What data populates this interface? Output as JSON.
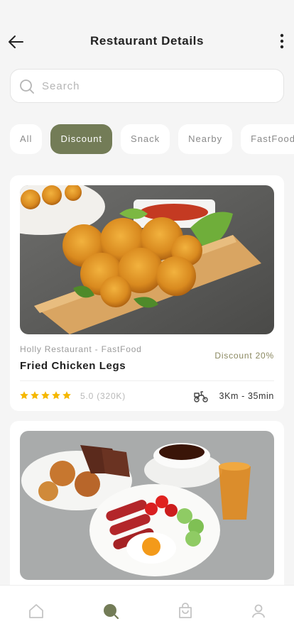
{
  "header": {
    "title": "Restaurant Details",
    "back_icon": "arrow-left-icon",
    "more_icon": "more-vertical-icon"
  },
  "search": {
    "placeholder": "Search",
    "value": "",
    "icon": "search-icon"
  },
  "categories": [
    {
      "label": "All",
      "active": false
    },
    {
      "label": "Discount",
      "active": true
    },
    {
      "label": "Snack",
      "active": false
    },
    {
      "label": "Nearby",
      "active": false
    },
    {
      "label": "FastFood",
      "active": false
    }
  ],
  "restaurants": [
    {
      "restaurant": "Holly Restaurant - FastFood",
      "dish": "Fried Chicken Legs",
      "discount": "Discount 20%",
      "stars": 5,
      "rating": "5.0 (320K)",
      "delivery": "3Km - 35min",
      "delivery_icon": "scooter-icon",
      "image": "fried-chicken-photo"
    },
    {
      "image": "breakfast-photo"
    }
  ],
  "tabbar": [
    {
      "name": "home",
      "icon": "home-icon",
      "active": false
    },
    {
      "name": "search",
      "icon": "search-icon",
      "active": true
    },
    {
      "name": "cart",
      "icon": "shopping-bag-icon",
      "active": false
    },
    {
      "name": "profile",
      "icon": "user-icon",
      "active": false
    }
  ],
  "colors": {
    "accent": "#737c57",
    "star": "#f5b700",
    "discount_text": "#8a8860",
    "background": "#f5f5f5",
    "icon_inactive": "#c4c4c4"
  }
}
